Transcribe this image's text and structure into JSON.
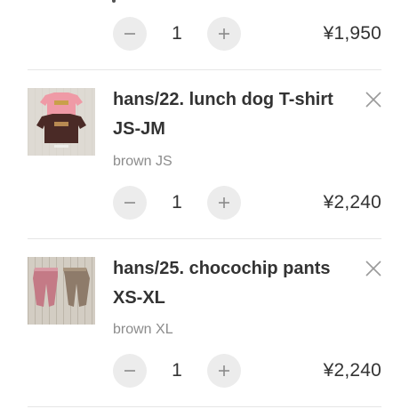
{
  "cart": {
    "partial_item": {
      "quantity": "1",
      "price": "¥1,950"
    },
    "items": [
      {
        "title": "hans/22. lunch dog T-shirt JS-JM",
        "variant": "brown JS",
        "quantity": "1",
        "price": "¥2,240",
        "thumbnail": "two-tshirts-photo"
      },
      {
        "title": "hans/25. chocochip pants XS-XL",
        "variant": "brown XL",
        "quantity": "1",
        "price": "¥2,240",
        "thumbnail": "two-pants-photo"
      }
    ]
  },
  "icons": {
    "decrease": "minus-icon",
    "increase": "plus-icon",
    "remove": "close-icon"
  },
  "colors": {
    "button_bg": "#ececec",
    "icon": "#8a8a8a",
    "divider": "#e6e6e6",
    "variant_text": "#8c8c8c"
  }
}
